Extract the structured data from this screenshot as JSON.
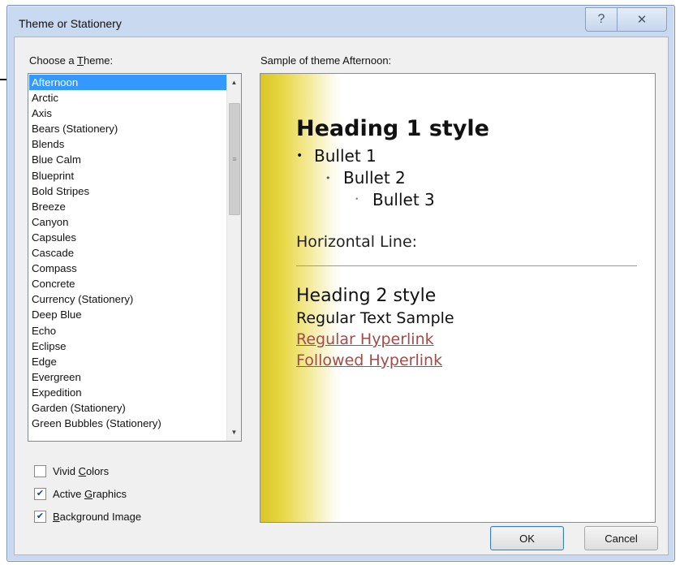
{
  "window": {
    "title": "Theme or Stationery",
    "help_glyph": "?",
    "close_glyph": "✕"
  },
  "theme_list": {
    "label_prefix": "Choose a ",
    "label_accel": "T",
    "label_suffix": "heme:",
    "selected": "Afternoon",
    "items": [
      "Afternoon",
      "Arctic",
      "Axis",
      "Bears (Stationery)",
      "Blends",
      "Blue Calm",
      "Blueprint",
      "Bold Stripes",
      "Breeze",
      "Canyon",
      "Capsules",
      "Cascade",
      "Compass",
      "Concrete",
      "Currency (Stationery)",
      "Deep Blue",
      "Echo",
      "Eclipse",
      "Edge",
      "Evergreen",
      "Expedition",
      "Garden (Stationery)",
      "Green Bubbles (Stationery)"
    ]
  },
  "options": {
    "vivid_colors": {
      "pre": "Vivid ",
      "accel": "C",
      "post": "olors",
      "checked": false
    },
    "active_graphics": {
      "pre": "Active ",
      "accel": "G",
      "post": "raphics",
      "checked": true
    },
    "background_image": {
      "pre": "",
      "accel": "B",
      "post": "ackground Image",
      "checked": true
    }
  },
  "preview": {
    "label": "Sample of theme Afternoon:",
    "heading1": "Heading 1 style",
    "bullet1": "Bullet 1",
    "bullet2": "Bullet 2",
    "bullet3": "Bullet 3",
    "horizontal_line_label": "Horizontal Line:",
    "heading2": "Heading 2 style",
    "regular_text": "Regular Text Sample",
    "hyperlink": "Regular Hyperlink",
    "followed_hyperlink": "Followed Hyperlink",
    "accent_color": "#d8c626",
    "link_color": "#a14b4b"
  },
  "buttons": {
    "ok": "OK",
    "cancel": "Cancel"
  }
}
